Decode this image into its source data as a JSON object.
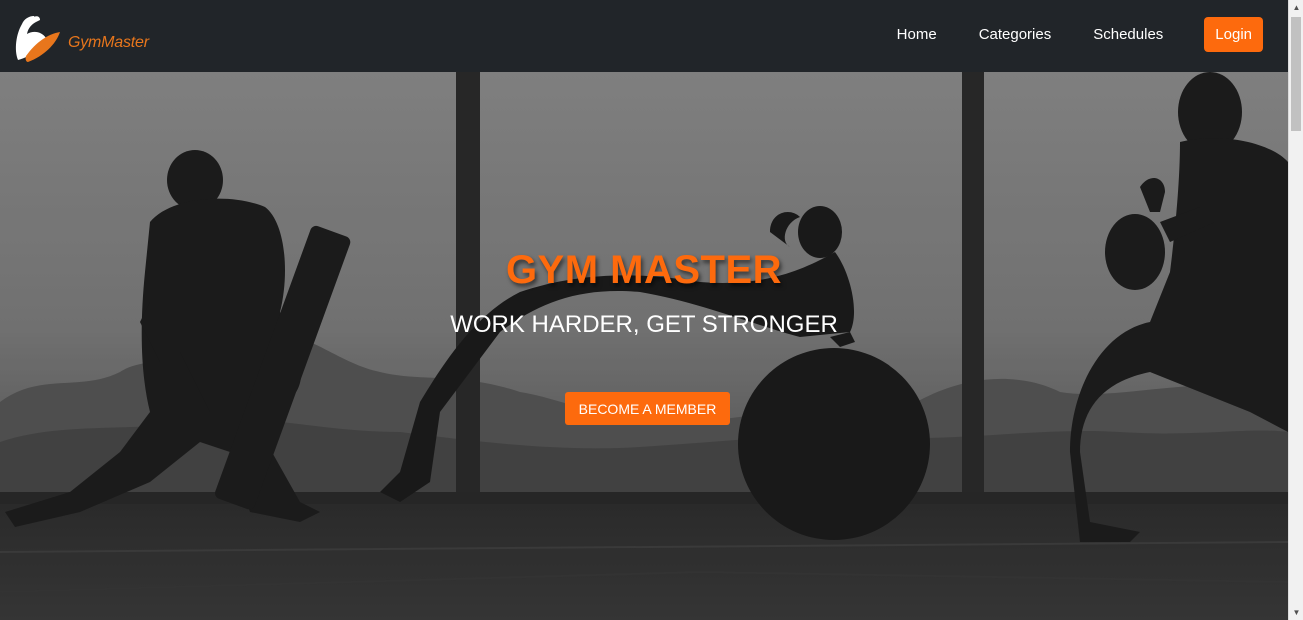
{
  "brand": {
    "name": "GymMaster",
    "logo_icon": "flexed-arm-icon",
    "accent_color": "#fd6a0d"
  },
  "nav": {
    "items": [
      {
        "label": "Home"
      },
      {
        "label": "Categories"
      },
      {
        "label": "Schedules"
      }
    ],
    "login_label": "Login"
  },
  "hero": {
    "title": "GYM MASTER",
    "subtitle": "WORK HARDER, GET STRONGER",
    "cta_label": "BECOME A MEMBER",
    "background_image": "gym-silhouettes-photo"
  },
  "scrollbar": {
    "up_icon": "arrow-up-icon",
    "down_icon": "arrow-down-icon"
  }
}
